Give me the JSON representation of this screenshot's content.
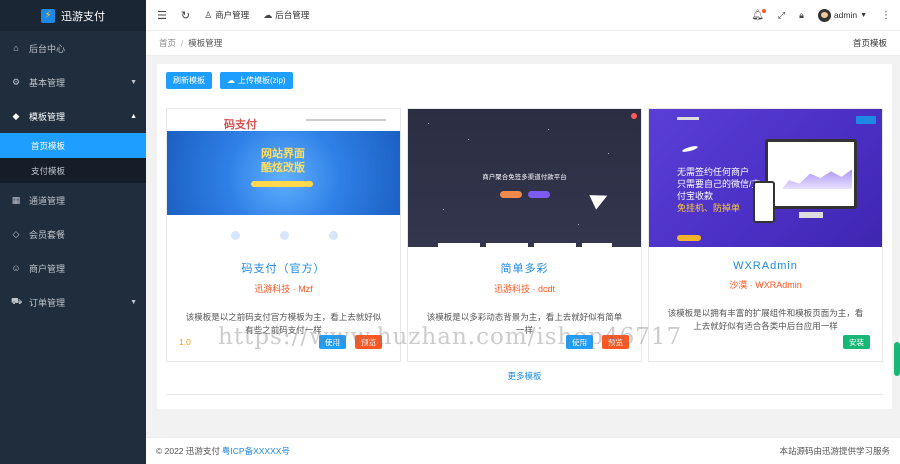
{
  "app": {
    "name": "迅游支付"
  },
  "sidebar": {
    "items": [
      {
        "label": "后台中心",
        "icon": "home-icon"
      },
      {
        "label": "基本管理",
        "icon": "gear-icon"
      },
      {
        "label": "模板管理",
        "icon": "cube-icon"
      },
      {
        "label": "通道管理",
        "icon": "grid-icon"
      },
      {
        "label": "会员套餐",
        "icon": "diamond-icon"
      },
      {
        "label": "商户管理",
        "icon": "user-icon"
      },
      {
        "label": "订单管理",
        "icon": "cart-icon"
      }
    ],
    "subitems": [
      {
        "label": "首页模板"
      },
      {
        "label": "支付模板"
      }
    ]
  },
  "header": {
    "merchant_label": "商户管理",
    "backend_label": "后台管理",
    "username": "admin"
  },
  "breadcrumb": {
    "home": "首页",
    "separator": "/",
    "current": "模板管理",
    "right_label": "首页模板"
  },
  "toolbar": {
    "refresh_label": "刷新模板",
    "upload_label": "上传模板(zip)"
  },
  "cards": [
    {
      "thumb_brand": "码支付",
      "thumb_line1": "网站界面",
      "thumb_line2": "酷炫改版",
      "title": "码支付（官方）",
      "author": "迅游科技 · Mzf",
      "desc": "该模板是以之前码支付官方模板为主，看上去就好似有些之前码支付一样",
      "version": "1.0",
      "use_label": "使用",
      "preview_label": "预览"
    },
    {
      "thumb_heading": "商户聚合免签多渠道付款平台",
      "title": "简单多彩",
      "author": "迅游科技 · dcdt",
      "desc": "该模板是以多彩动态背景为主，看上去就好似有简单一样",
      "use_label": "使用",
      "preview_label": "预览"
    },
    {
      "thumb_line1": "无需签约任何商户",
      "thumb_line2": "只需要自己的微信/支付宝收款",
      "thumb_line3": "免挂机、防掉单",
      "title": "WXRAdmin",
      "author": "沙漠 · WXRAdmin",
      "desc": "该模板是以拥有丰富的扩展组件和模板页面为主，看上去就好似有适合各类中后台应用一样",
      "install_label": "安装"
    }
  ],
  "more_label": "更多模板",
  "footer": {
    "copyright": "© 2022 迅游支付",
    "icp": "粤ICP备XXXXX号",
    "right_text": "本站源码由迅游提供学习服务"
  },
  "watermark": "https://www.huzhan.com/ishop46717",
  "colors": {
    "sidebar_bg": "#1f2d3d",
    "accent_blue": "#1e9fff",
    "preview_orange": "#ff5722",
    "install_green": "#16b777"
  }
}
